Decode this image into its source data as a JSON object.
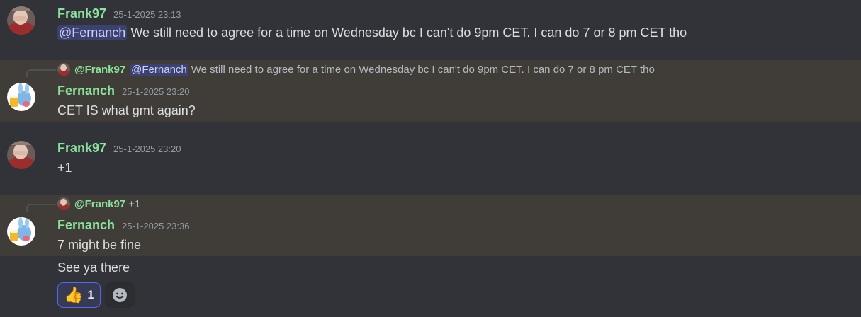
{
  "messages": [
    {
      "username": "Frank97",
      "timestamp": "25-1-2025 23:13",
      "mention": "@Fernanch",
      "text": " We still need to agree for a time on Wednesday bc I can't do 9pm CET. I can do 7 or 8 pm CET tho"
    },
    {
      "reply": {
        "username": "@Frank97",
        "mention": "@Fernanch",
        "text": "We still need to agree for a time on Wednesday bc I can't do 9pm CET. I can do 7 or 8 pm CET tho"
      },
      "username": "Fernanch",
      "timestamp": "25-1-2025 23:20",
      "text": "CET IS what gmt again?"
    },
    {
      "username": "Frank97",
      "timestamp": "25-1-2025 23:20",
      "text": "+1"
    },
    {
      "reply": {
        "username": "@Frank97",
        "text": "+1"
      },
      "username": "Fernanch",
      "timestamp": "25-1-2025 23:36",
      "text": "7 might be fine",
      "followup_text": "See ya there"
    }
  ],
  "reactions": [
    {
      "emoji": "👍",
      "count": "1"
    }
  ],
  "colors": {
    "background": "#313338",
    "highlight": "#403d38",
    "username": "#8ae39c",
    "mention_bg": "#3c4270",
    "reaction_border": "#5865f2"
  },
  "icons": {
    "add_reaction": "smile-icon"
  }
}
